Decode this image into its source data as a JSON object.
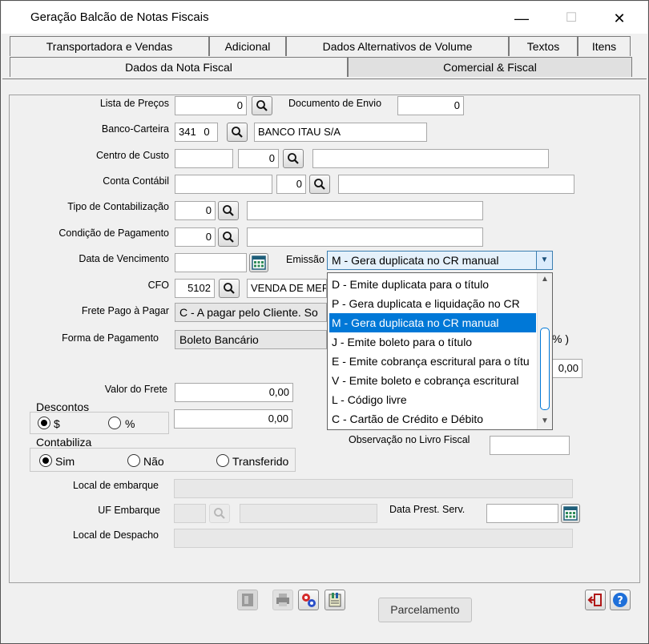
{
  "window": {
    "title": "Geração Balcão de Notas Fiscais",
    "minimize": "—",
    "maximize": "☐",
    "close": "✕"
  },
  "tabs": {
    "row1": [
      "Transportadora e Vendas",
      "Adicional",
      "Dados Alternativos de Volume",
      "Textos",
      "Itens"
    ],
    "row2": [
      "Dados da Nota Fiscal",
      "Comercial & Fiscal"
    ],
    "active": "Comercial & Fiscal"
  },
  "form": {
    "lista_precos": {
      "label": "Lista de Preços",
      "value": "0"
    },
    "documento_envio": {
      "label": "Documento de Envio",
      "value": "0"
    },
    "banco_carteira": {
      "label": "Banco-Carteira",
      "banco": "341",
      "carteira": "0",
      "nome": "BANCO ITAU S/A"
    },
    "centro_custo": {
      "label": "Centro de Custo",
      "codigo": "",
      "valor": "0",
      "descricao": ""
    },
    "conta_contabil": {
      "label": "Conta Contábil",
      "codigo": "",
      "valor": "0",
      "descricao": ""
    },
    "tipo_contabilizacao": {
      "label": "Tipo de Contabilização",
      "value": "0",
      "descricao": ""
    },
    "condicao_pagamento": {
      "label": "Condição de Pagamento",
      "value": "0",
      "descricao": ""
    },
    "data_vencimento": {
      "label": "Data de Vencimento",
      "value": ""
    },
    "emissao": {
      "label": "Emissão",
      "value": "M - Gera duplicata no CR manual"
    },
    "cfo": {
      "label": "CFO",
      "value": "5102",
      "descricao": "VENDA DE MER"
    },
    "frete_pago": {
      "label": "Frete Pago à Pagar",
      "value": "C - A pagar pelo Cliente. So"
    },
    "forma_pagamento": {
      "label": "Forma de Pagamento",
      "value": "Boleto Bancário",
      "suffix": "% )"
    },
    "aux_valor": "0,00",
    "valor_frete": {
      "label": "Valor do Frete",
      "value": "0,00"
    },
    "descontos": {
      "label": "Descontos",
      "opt_cifrao": "$",
      "opt_pct": "%",
      "value": "0,00"
    },
    "contabiliza": {
      "label": "Contabiliza",
      "opt_sim": "Sim",
      "opt_nao": "Não",
      "opt_transf": "Transferido"
    },
    "obs_livro_fiscal": {
      "label": "Observação no Livro Fiscal",
      "value": ""
    },
    "local_embarque": {
      "label": "Local de embarque",
      "value": ""
    },
    "uf_embarque": {
      "label": "UF Embarque",
      "value": "",
      "descricao": ""
    },
    "data_prest_serv": {
      "label": "Data Prest. Serv.",
      "value": ""
    },
    "local_despacho": {
      "label": "Local de Despacho",
      "value": ""
    }
  },
  "emissao_options": [
    "D - Emite duplicata para o título",
    "P - Gera duplicata e liquidação no CR",
    "M - Gera duplicata no CR manual",
    "J  - Emite boleto para o título",
    "E - Emite cobrança escritural para o títu",
    "V - Emite boleto e cobrança escritural",
    "L - Código livre",
    "C - Cartão de Crédito e Débito"
  ],
  "emissao_selected_index": 2,
  "footer": {
    "parcelamento": "Parcelamento"
  },
  "colors": {
    "selection": "#0078d7",
    "focus_border": "#3c7fb1"
  }
}
